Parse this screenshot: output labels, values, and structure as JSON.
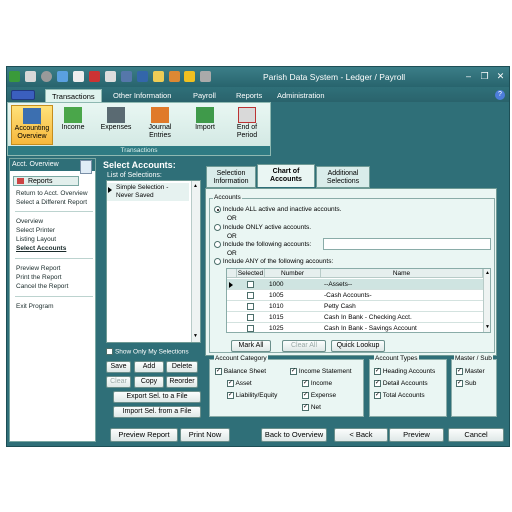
{
  "window": {
    "title": "Parish Data System -  Ledger / Payroll",
    "controls": {
      "minimize": "–",
      "restore": "❐",
      "close": "✕"
    }
  },
  "menu": {
    "tabs": [
      {
        "label": "Transactions",
        "active": true
      },
      {
        "label": "Other Information"
      },
      {
        "label": "Payroll"
      },
      {
        "label": "Reports"
      },
      {
        "label": "Administration"
      }
    ],
    "help": "?"
  },
  "ribbon": {
    "buttons": [
      {
        "label_line1": "Accounting",
        "label_line2": "Overview",
        "selected": true
      },
      {
        "label_line1": "Income",
        "label_line2": ""
      },
      {
        "label_line1": "Expenses",
        "label_line2": ""
      },
      {
        "label_line1": "Journal",
        "label_line2": "Entries"
      },
      {
        "label_line1": "Import",
        "label_line2": ""
      },
      {
        "label_line1": "End of",
        "label_line2": "Period"
      }
    ],
    "group_label": "Transactions"
  },
  "left_panel": {
    "title": "Acct. Overview",
    "tab": "Reports",
    "links_a": [
      "Return to Acct. Overview",
      "Select a Different Report"
    ],
    "links_b": [
      "Overview",
      "Select Printer",
      "Listing Layout",
      "Select Accounts"
    ],
    "links_c": [
      "Preview Report",
      "Print the Report",
      "Cancel the Report"
    ],
    "links_d": [
      "Exit Program"
    ]
  },
  "select_accounts": {
    "heading": "Select Accounts:",
    "list_label": "List of Selections:",
    "list_items": [
      "Simple Selection -",
      "Never Saved"
    ],
    "show_only_label": "Show Only My Selections",
    "buttons": {
      "save": "Save",
      "add": "Add",
      "delete": "Delete",
      "clear": "Clear",
      "copy": "Copy",
      "reorder": "Reorder",
      "export": "Export Sel. to a File",
      "import": "Import Sel. from a File"
    }
  },
  "tabs": [
    {
      "line1": "Selection",
      "line2": "Information"
    },
    {
      "line1": "Chart of",
      "line2": "Accounts",
      "active": true
    },
    {
      "line1": "Additional",
      "line2": "Selections"
    }
  ],
  "accounts": {
    "group_label": "Accounts",
    "options": [
      {
        "label": "Include ALL active and inactive accounts.",
        "selected": true
      },
      {
        "label": "Include ONLY active accounts."
      },
      {
        "label": "Include the following accounts:"
      },
      {
        "label": "Include ANY of the following accounts:"
      }
    ],
    "or_label": "OR",
    "following_accounts_value": "",
    "grid": {
      "headers": [
        "Selected",
        "Number",
        "Name"
      ],
      "rows": [
        {
          "number": "1000",
          "name": "--Assets--",
          "selected": true
        },
        {
          "number": "1005",
          "name": "-Cash Accounts-"
        },
        {
          "number": "1010",
          "name": "Petty Cash"
        },
        {
          "number": "1015",
          "name": "Cash In Bank - Checking Acct."
        },
        {
          "number": "1025",
          "name": "Cash In Bank - Savings Account"
        }
      ]
    },
    "mark_all": "Mark All",
    "clear_all": "Clear All",
    "quick_lookup": "Quick Lookup"
  },
  "account_category": {
    "label": "Account Category",
    "balance_sheet": "Balance Sheet",
    "asset": "Asset",
    "liability_equity": "Liability/Equity",
    "income_statement": "Income Statement",
    "income": "Income",
    "expense": "Expense",
    "net": "Net"
  },
  "account_types": {
    "label": "Account Types",
    "heading": "Heading Accounts",
    "detail": "Detail Accounts",
    "total": "Total Accounts"
  },
  "master_sub": {
    "label": "Master / Sub",
    "master": "Master",
    "sub": "Sub"
  },
  "footer": {
    "preview_report": "Preview Report",
    "print_now": "Print Now",
    "back_to_overview": "Back to Overview",
    "back": "< Back",
    "preview": "Preview",
    "cancel": "Cancel"
  },
  "check_mark": "✓"
}
